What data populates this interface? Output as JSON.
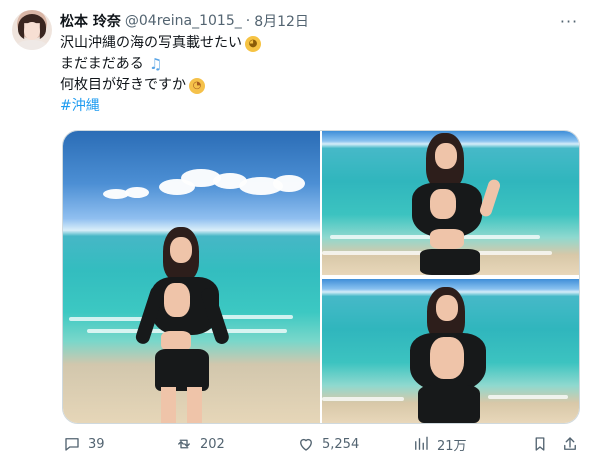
{
  "user": {
    "display_name": "松本 玲奈",
    "handle": "@04reina_1015_",
    "separator": "·",
    "date": "8月12日"
  },
  "tweet": {
    "line1": "沢山沖縄の海の写真載せたい",
    "line2": "まだまだある",
    "line3": "何枚目が好きですか",
    "hashtag": "#沖縄"
  },
  "actions": {
    "replies": "39",
    "retweets": "202",
    "likes": "5,254",
    "views": "21万"
  },
  "icons": {
    "more": "more-icon",
    "reply": "reply-icon",
    "retweet": "retweet-icon",
    "like": "heart-icon",
    "views": "views-icon",
    "bookmark": "bookmark-icon",
    "share": "share-icon"
  },
  "colors": {
    "accent": "#1d9bf0",
    "secondary_text": "#536471",
    "primary_text": "#0f1419"
  }
}
